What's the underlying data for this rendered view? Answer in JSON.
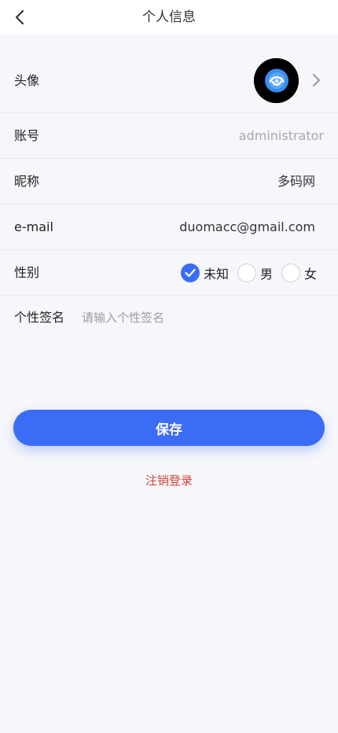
{
  "header": {
    "title": "个人信息"
  },
  "profile": {
    "avatar_label": "头像",
    "account_label": "账号",
    "account_value": "administrator",
    "nickname_label": "昵称",
    "nickname_value": "多码网",
    "email_label": "e-mail",
    "email_value": "duomacc@gmail.com",
    "gender_label": "性别",
    "gender_options": [
      "未知",
      "男",
      "女"
    ],
    "gender_selected": "未知",
    "signature_label": "个性签名",
    "signature_placeholder": "请输入个性签名",
    "signature_value": ""
  },
  "actions": {
    "save_label": "保存",
    "logout_label": "注销登录"
  },
  "colors": {
    "accent": "#3b6cf6",
    "danger": "#d0473a",
    "background": "#f6f7fb"
  },
  "icons": [
    "back-arrow-icon",
    "chevron-right-icon",
    "checkmark-icon"
  ]
}
